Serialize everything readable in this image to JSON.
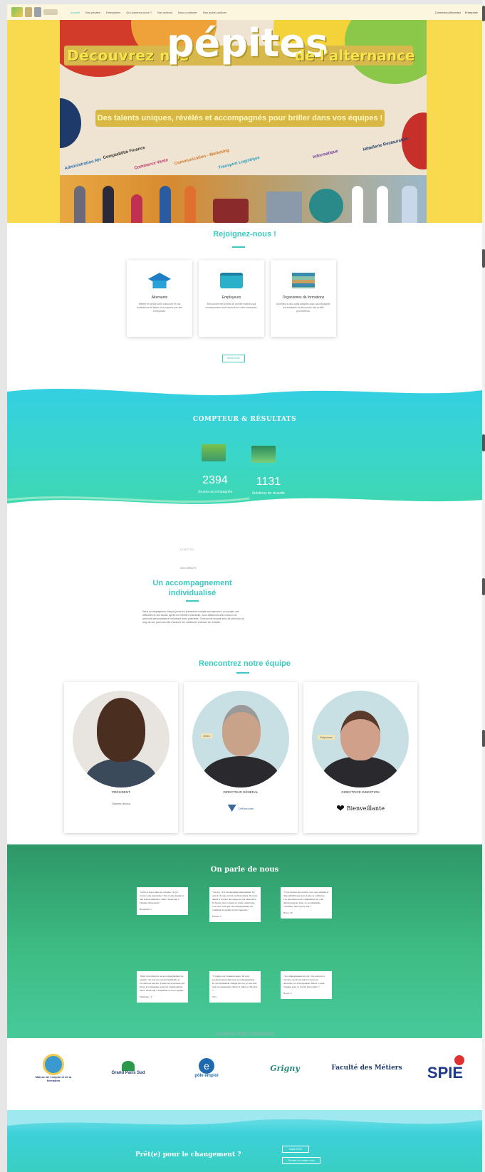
{
  "nav": {
    "items": [
      "Accueil",
      "Nos pépites",
      "Entreprises",
      "Qui sommes-nous ?",
      "Nos actions",
      "Nous contacter",
      "Nos autres actions"
    ],
    "right": [
      "Connexion Alternant",
      "Entreprise"
    ]
  },
  "hero": {
    "title_part1": "Découvrez nos",
    "title_big": "pépites",
    "title_part2": "de l'alternance",
    "subtitle": "Des talents uniques, révélés et accompagnés pour briller dans vos équipes !",
    "categories": [
      "Administration RH",
      "Comptabilité Finance",
      "Commerce Vente",
      "Communication - Marketing",
      "Transport Logistique",
      "Informatique",
      "Hôtellerie Restauration"
    ]
  },
  "join": {
    "title": "Rejoignez-nous !",
    "cards": [
      {
        "title": "Alternants",
        "desc": "Mettez en avant votre parcours et vos motivations et faites vous repérer par des entreprises."
      },
      {
        "title": "Employeurs",
        "desc": "Découvrez des profils de jeunes motivés qui correspondent aux besoins de votre entreprise."
      },
      {
        "title": "Organismes de formations",
        "desc": "Accédez à des outils adaptés pour accompagner les étudiants et découvrez des profils prometteurs."
      }
    ],
    "button": "Nous écrire"
  },
  "counter": {
    "title": "COMPTEUR & RÉSULTATS",
    "stats": [
      {
        "value": "2394",
        "label": "Jeunes accompagnés"
      },
      {
        "value": "1131",
        "label": "Solutions de réussite"
      }
    ]
  },
  "accompaniment": {
    "kicker": "LE MOT DU",
    "label": "NOS DÉBUTS",
    "title": "Un accompagnement individualisé",
    "text": "Nous accompagnons chaque jeune en prenant en compte son parcours, son projet, ses difficultés et ses atouts. Après un entretien individuel, nous élaborons avec chacun un parcours personnalisé et valorisant leurs potentiels. Chacun est ensuite suivi de près tout au long de son parcours afin d'assurer les meilleures chances de réussite."
  },
  "team": {
    "title": "Rencontrez notre équipe",
    "members": [
      {
        "role": "PRÉSIDENT",
        "subrole": "Salomé Abdou",
        "tag": ""
      },
      {
        "role": "DIRECTEUR GÉNÉRAL",
        "subrole": "",
        "tag": "Gilles",
        "company": "Défiomonde"
      },
      {
        "role": "DIRECTRICE INSERTION",
        "subrole": "",
        "tag": "Stéphanie",
        "company": "Bienveillante"
      }
    ]
  },
  "testimonials": {
    "title": "On parle de nous",
    "quotes": [
      {
        "text": "\"Grâce à leurs idées et conseils, j'ai pu trouver une entreprise ! Une bonne équipe et une bonne ambiance. Merci beaucoup à l'équipe d'insertion!\"",
        "author": "Benjamin. L"
      },
      {
        "text": "\"Au top ! Un encadrement bienveillant. Ils sont à l'écoute et très professionnels. Ils nous aident à trouver des stages et une alternance. Si besoin d'un conseil ou d'une orientation, c'est avec eux que l'accompagnement est vraiment de qualité et très apprécié.\"",
        "author": "Dialan. S"
      },
      {
        "text": "\"C'est un lieu incroyable, avec une attitude et disponibilité qui nous donne la confiance. Les personnes sont compétentes et vous aident jusqu'au bout. Je recommande vivement, merci pour tout !\"",
        "author": "Barry. M"
      },
      {
        "text": "\"Rien d'excellent et un accompagnement de qualité ! Ils font un travail formidable et l'accueil est sincère. Toutes les personnes qui m'ont accompagnée sont très attentionnées, merci beaucoup à Stéphanie et à son équipe.\"",
        "author": "Stéphanie. V"
      },
      {
        "text": "\"L'équipe est vraiment super. Ils sont professionnels dans leur accompagnement. Ils ont réellement changé ma vie, je leur suis très reconnaissante. Merci à Gilles et Nicolas !\"",
        "author": "Nico"
      },
      {
        "text": "\"Accompagnement au top ! Ils sont très à l'écoute, ils m'ont aidé à trouver un alternance et à m'organiser. Merci à toute l'équipe pour ce travail incroyable !\"",
        "author": "Bouri. F"
      }
    ]
  },
  "partners": {
    "label": "ILS NOUS FONT CONFIANCE",
    "items": [
      "Maison de l'emploi et de la formation",
      "Grand Paris Sud",
      "pôle emploi",
      "Grigny",
      "Faculté des Métiers",
      "SPIE"
    ]
  },
  "cta": {
    "title": "Prêt(e) pour le changement ?",
    "btn1": "Nous écrire",
    "btn2": "Prendre un rendez-vous"
  },
  "colors": {
    "accent": "#3cc9bf",
    "hero_yellow": "#f9d94d",
    "counter_teal": "#34cfe3",
    "testimonial_green": "#2e9767"
  }
}
